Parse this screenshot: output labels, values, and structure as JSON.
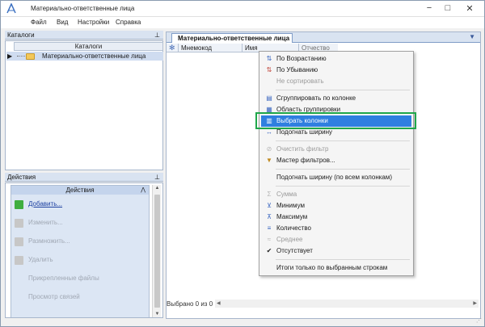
{
  "window": {
    "title": "Материально-ответственные лица",
    "controls": {
      "minimize": "−",
      "maximize": "□",
      "close": "✕"
    }
  },
  "menu": [
    "Файл",
    "Вид",
    "Настройки",
    "Справка"
  ],
  "catalogs_panel": {
    "title": "Каталоги",
    "pin": "⊥",
    "column_header": "Каталоги",
    "row_arrow": "▶",
    "rows": [
      "Материально-ответственные лица"
    ]
  },
  "actions_panel": {
    "title": "Действия",
    "pin": "⊥",
    "group_title": "Действия",
    "collapse": "⋀",
    "items": [
      {
        "label": "Добавить...",
        "enabled": true,
        "icon": "add-icon",
        "color": "#3fae3f"
      },
      {
        "label": "Изменить...",
        "enabled": false,
        "icon": "edit-icon",
        "color": "#c7c7c7"
      },
      {
        "label": "Размножить...",
        "enabled": false,
        "icon": "copy-icon",
        "color": "#c7c7c7"
      },
      {
        "label": "Удалить",
        "enabled": false,
        "icon": "delete-icon",
        "color": "#c7c7c7"
      },
      {
        "label": "Прикрепленные файлы",
        "enabled": false,
        "icon": "",
        "color": ""
      },
      {
        "label": "Просмотр связей",
        "enabled": false,
        "icon": "",
        "color": ""
      }
    ]
  },
  "main_panel": {
    "tab_label": "Материально-ответственные лица",
    "tab_dropdown": "▼",
    "grid_star": "✻",
    "columns": [
      "Мнемокод",
      "Имя",
      "Отчество"
    ],
    "status": "Выбрано 0 из 0",
    "scroll_left": "◀",
    "scroll_right": "▶"
  },
  "context_menu": {
    "items": [
      {
        "type": "item",
        "label": "По Возрастанию",
        "icon": "sort-asc-icon",
        "glyph": "⇅",
        "enabled": true
      },
      {
        "type": "item",
        "label": "По Убыванию",
        "icon": "sort-desc-icon",
        "glyph": "⇅",
        "enabled": true
      },
      {
        "type": "item",
        "label": "Не сортировать",
        "icon": "",
        "glyph": "",
        "enabled": false
      },
      {
        "type": "sep"
      },
      {
        "type": "item",
        "label": "Сгруппировать по колонке",
        "icon": "group-by-column-icon",
        "glyph": "▤",
        "enabled": true
      },
      {
        "type": "item",
        "label": "Область группировки",
        "icon": "group-area-icon",
        "glyph": "▦",
        "enabled": true
      },
      {
        "type": "item",
        "label": "Выбрать колонки",
        "icon": "choose-columns-icon",
        "glyph": "▥",
        "enabled": true,
        "highlight": true
      },
      {
        "type": "item",
        "label": "Подогнать ширину",
        "icon": "fit-width-icon",
        "glyph": "↔",
        "enabled": true
      },
      {
        "type": "sep"
      },
      {
        "type": "item",
        "label": "Очистить фильтр",
        "icon": "clear-filter-icon",
        "glyph": "⊘",
        "enabled": false
      },
      {
        "type": "item",
        "label": "Мастер фильтров...",
        "icon": "filter-wizard-icon",
        "glyph": "▼",
        "enabled": true
      },
      {
        "type": "sep"
      },
      {
        "type": "item",
        "label": "Подогнать ширину (по всем колонкам)",
        "icon": "",
        "glyph": "",
        "enabled": true
      },
      {
        "type": "sep"
      },
      {
        "type": "item",
        "label": "Сумма",
        "icon": "sum-icon",
        "glyph": "Σ",
        "enabled": false
      },
      {
        "type": "item",
        "label": "Минимум",
        "icon": "min-icon",
        "glyph": "⊻",
        "enabled": true
      },
      {
        "type": "item",
        "label": "Максимум",
        "icon": "max-icon",
        "glyph": "⊼",
        "enabled": true
      },
      {
        "type": "item",
        "label": "Количество",
        "icon": "count-icon",
        "glyph": "≡",
        "enabled": true
      },
      {
        "type": "item",
        "label": "Среднее",
        "icon": "average-icon",
        "glyph": "≈",
        "enabled": false
      },
      {
        "type": "item",
        "label": "Отсутствует",
        "icon": "check-icon",
        "glyph": "✔",
        "enabled": true
      },
      {
        "type": "sep"
      },
      {
        "type": "item",
        "label": "Итоги только по выбранным строкам",
        "icon": "",
        "glyph": "",
        "enabled": true
      }
    ]
  },
  "colors": {
    "highlight": "#2f7fe0",
    "frame": "#1fa64a",
    "panel_header": "#d9e3f1"
  }
}
